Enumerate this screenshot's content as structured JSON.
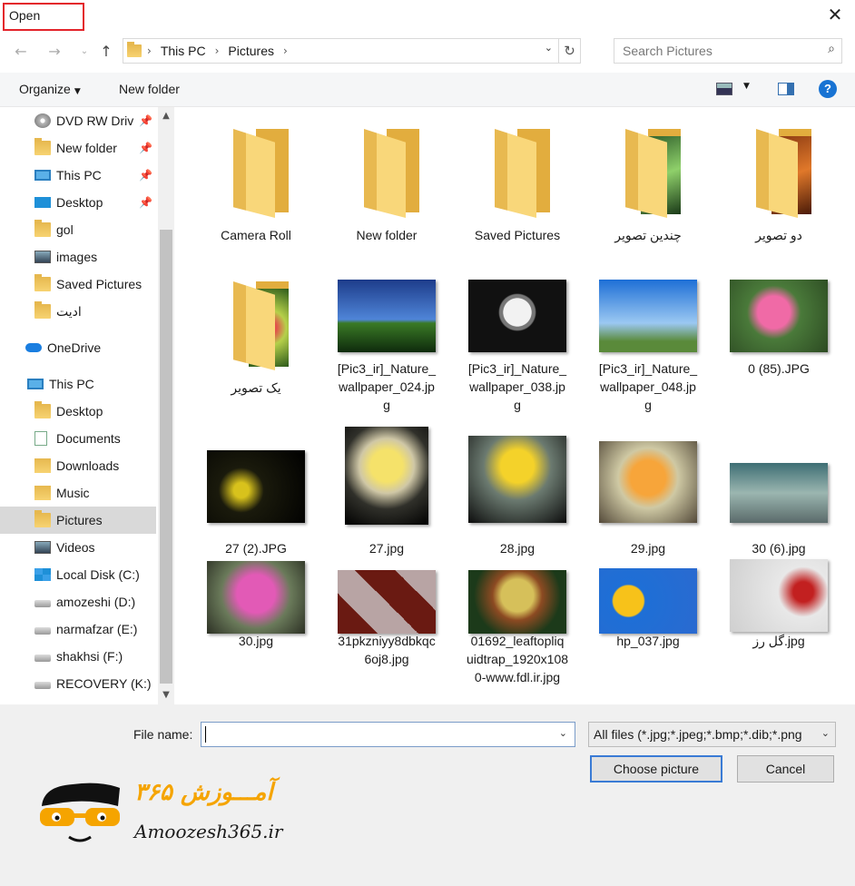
{
  "window": {
    "title": "Open",
    "close_glyph": "✕"
  },
  "nav": {
    "back": "←",
    "forward": "→",
    "recent": "⌄",
    "up": "↑"
  },
  "address": {
    "crumbs": [
      "This PC",
      "Pictures"
    ],
    "sep": "›",
    "dropdown": "⌄",
    "refresh": "↻"
  },
  "search": {
    "placeholder": "Search Pictures",
    "icon": "⌕"
  },
  "toolbar": {
    "organize": "Organize",
    "organize_caret": "▼",
    "new_folder": "New folder",
    "view_caret": "▼",
    "help": "?"
  },
  "sidebar": {
    "items": [
      {
        "label": "DVD RW Driv",
        "icon": "dvd-drive-icon",
        "pinned": true
      },
      {
        "label": "New folder",
        "icon": "folder-icon",
        "pinned": true
      },
      {
        "label": "This PC",
        "icon": "computer-icon",
        "pinned": true
      },
      {
        "label": "Desktop",
        "icon": "desktop-icon",
        "pinned": true
      },
      {
        "label": "gol",
        "icon": "folder-icon"
      },
      {
        "label": "images",
        "icon": "image-folder-icon"
      },
      {
        "label": "Saved Pictures",
        "icon": "folder-icon"
      },
      {
        "label": "ادیت",
        "icon": "folder-icon"
      },
      {
        "label": "OneDrive",
        "icon": "cloud-icon"
      },
      {
        "label": "This PC",
        "icon": "computer-icon"
      },
      {
        "label": "Desktop",
        "icon": "folder-icon"
      },
      {
        "label": "Documents",
        "icon": "documents-icon"
      },
      {
        "label": "Downloads",
        "icon": "downloads-icon"
      },
      {
        "label": "Music",
        "icon": "music-icon"
      },
      {
        "label": "Pictures",
        "icon": "pictures-icon",
        "selected": true
      },
      {
        "label": "Videos",
        "icon": "videos-icon"
      },
      {
        "label": "Local Disk (C:)",
        "icon": "windows-drive-icon"
      },
      {
        "label": "amozeshi (D:)",
        "icon": "drive-icon"
      },
      {
        "label": "narmafzar (E:)",
        "icon": "drive-icon"
      },
      {
        "label": "shakhsi (F:)",
        "icon": "drive-icon"
      },
      {
        "label": "RECOVERY (K:)",
        "icon": "drive-icon"
      }
    ],
    "pin_glyph": "📌",
    "scroll_up": "▲",
    "scroll_down": "▼"
  },
  "files": {
    "row1": [
      {
        "label": "Camera Roll",
        "kind": "folder"
      },
      {
        "label": "New folder",
        "kind": "folder"
      },
      {
        "label": "Saved Pictures",
        "kind": "folder"
      },
      {
        "label": "چندین تصویر",
        "kind": "folder-photos"
      },
      {
        "label": "دو تصویر",
        "kind": "folder-photos"
      }
    ],
    "row2": [
      {
        "label": "یک تصویر",
        "kind": "folder-photos"
      },
      {
        "label_lines": [
          "[Pic3_ir]_Nature_",
          "wallpaper_024.jp",
          "g"
        ],
        "kind": "image"
      },
      {
        "label_lines": [
          "[Pic3_ir]_Nature_",
          "wallpaper_038.jp",
          "g"
        ],
        "kind": "image"
      },
      {
        "label_lines": [
          "[Pic3_ir]_Nature_",
          "wallpaper_048.jp",
          "g"
        ],
        "kind": "image"
      },
      {
        "label": "0 (85).JPG",
        "kind": "image"
      }
    ],
    "row3": [
      {
        "label": "27 (2).JPG",
        "kind": "image"
      },
      {
        "label": "27.jpg",
        "kind": "image"
      },
      {
        "label": "28.jpg",
        "kind": "image"
      },
      {
        "label": "29.jpg",
        "kind": "image"
      },
      {
        "label": "30 (6).jpg",
        "kind": "image"
      }
    ],
    "row4": [
      {
        "label": "30.jpg",
        "kind": "image"
      },
      {
        "label_lines": [
          "31pkzniyy8dbkqc",
          "6oj8.jpg"
        ],
        "kind": "image"
      },
      {
        "label_lines": [
          "01692_leaftopliq",
          "uidtrap_1920x108",
          "0-www.fdl.ir.jpg"
        ],
        "kind": "image"
      },
      {
        "label": "hp_037.jpg",
        "kind": "image"
      },
      {
        "label": "گل رز.jpg",
        "kind": "image"
      }
    ]
  },
  "footer": {
    "file_name_label": "File name:",
    "file_name_value": "",
    "dropdown": "⌄",
    "file_type": "All files (*.jpg;*.jpeg;*.bmp;*.dib;*.png",
    "open_button": "Choose picture",
    "cancel_button": "Cancel"
  },
  "watermark": {
    "persian": "آمـــوزش ۳۶۵",
    "english": "Amoozesh365.ir"
  },
  "colors": {
    "accent": "#3a7bd5",
    "title_highlight": "#e3242b",
    "brand_orange": "#f5a400",
    "folder": "#f7d371"
  }
}
